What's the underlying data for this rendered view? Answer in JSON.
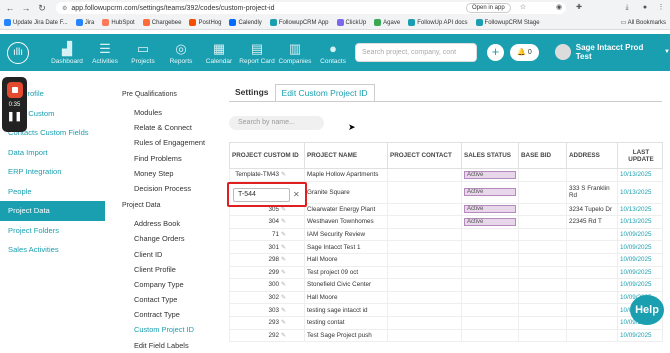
{
  "browser": {
    "url": "app.followupcrm.com/settings/teams/392/codes/custom-project-id",
    "open_in_app": "Open in app",
    "all_bookmarks": "All Bookmarks",
    "bookmarks": [
      {
        "label": "Update Jira Date F...",
        "color": "#2684ff"
      },
      {
        "label": "Jira",
        "color": "#2684ff"
      },
      {
        "label": "HubSpot",
        "color": "#ff7a59"
      },
      {
        "label": "Chargebee",
        "color": "#ff6c37"
      },
      {
        "label": "PostHog",
        "color": "#f54e00"
      },
      {
        "label": "Calendly",
        "color": "#006bff"
      },
      {
        "label": "FollowupCRM App",
        "color": "#1a9fb0"
      },
      {
        "label": "ClickUp",
        "color": "#7b68ee"
      },
      {
        "label": "Agave",
        "color": "#3aa757"
      },
      {
        "label": "FollowUp API docs",
        "color": "#1a9fb0"
      },
      {
        "label": "FollowupCRM Stage",
        "color": "#1a9fb0"
      }
    ]
  },
  "appbar": {
    "nav": [
      {
        "label": "Dashboard",
        "icon": "▟"
      },
      {
        "label": "Activities",
        "icon": "☰"
      },
      {
        "label": "Projects",
        "icon": "▭"
      },
      {
        "label": "Reports",
        "icon": "◎"
      },
      {
        "label": "Calendar",
        "icon": "▦"
      },
      {
        "label": "Report Card",
        "icon": "▤"
      },
      {
        "label": "Companies",
        "icon": "▥"
      },
      {
        "label": "Contacts",
        "icon": "●"
      }
    ],
    "search_placeholder": "Search project, company, cont",
    "notif_count": "0",
    "user_name": "Sage Intacct Prod Test"
  },
  "recorder": {
    "time": "0:35"
  },
  "sidebar": [
    {
      "label": "any Profile",
      "active": false
    },
    {
      "label": "anies Custom",
      "active": false
    },
    {
      "label": "Contacts Custom Fields",
      "active": false
    },
    {
      "label": "Data Import",
      "active": false
    },
    {
      "label": "ERP Integration",
      "active": false
    },
    {
      "label": "People",
      "active": false
    },
    {
      "label": "Project Data",
      "active": true
    },
    {
      "label": "Project Folders",
      "active": false
    },
    {
      "label": "Sales Activities",
      "active": false
    }
  ],
  "subnav": {
    "pre_heading": "Pre Qualifications",
    "pre_items": [
      "Modules",
      "Relate & Connect",
      "Rules of Engagement",
      "Find Problems",
      "Money Step",
      "Decision Process"
    ],
    "data_heading": "Project Data",
    "data_items": [
      "Address Book",
      "Change Orders",
      "Client ID",
      "Client Profile",
      "Company Type",
      "Contact Type",
      "Contract Type",
      "Custom Project ID",
      "Edit Field Labels"
    ],
    "active_item": "Custom Project ID"
  },
  "tabs": {
    "settings": "Settings",
    "edit": "Edit Custom Project ID"
  },
  "table": {
    "search_placeholder": "Search by name...",
    "headers": [
      "PROJECT CUSTOM ID",
      "PROJECT NAME",
      "PROJECT CONTACT",
      "SALES STATUS",
      "BASE BID",
      "ADDRESS",
      "LAST UPDATE"
    ],
    "edit_value": "T-544",
    "rows": [
      {
        "id": "Template-TM43",
        "name": "Maple Hollow Apartments",
        "contact": "",
        "status": "Active",
        "bid": "",
        "address": "",
        "date": "10/13/2025"
      },
      {
        "id": "",
        "name": "Granite Square",
        "contact": "",
        "status": "Active",
        "bid": "",
        "address": "333 S Franklin Rd",
        "date": "10/13/2025"
      },
      {
        "id": "305",
        "name": "Clearwater Energy Plant",
        "contact": "",
        "status": "Active",
        "bid": "",
        "address": "3234 Tupelo Dr",
        "date": "10/13/2025"
      },
      {
        "id": "304",
        "name": "Westhaven Townhomes",
        "contact": "",
        "status": "Active",
        "bid": "",
        "address": "22345 Rd T",
        "date": "10/13/2025"
      },
      {
        "id": "71",
        "name": "IAM Security Review",
        "contact": "",
        "status": "",
        "bid": "",
        "address": "",
        "date": "10/09/2025"
      },
      {
        "id": "301",
        "name": "Sage Intacct Test 1",
        "contact": "",
        "status": "",
        "bid": "",
        "address": "",
        "date": "10/09/2025"
      },
      {
        "id": "298",
        "name": "Hall Moore",
        "contact": "",
        "status": "",
        "bid": "",
        "address": "",
        "date": "10/09/2025"
      },
      {
        "id": "299",
        "name": "Test project 09 oct",
        "contact": "",
        "status": "",
        "bid": "",
        "address": "",
        "date": "10/09/2025"
      },
      {
        "id": "300",
        "name": "Stonefield Civic Center",
        "contact": "",
        "status": "",
        "bid": "",
        "address": "",
        "date": "10/09/2025"
      },
      {
        "id": "302",
        "name": "Hall Moore",
        "contact": "",
        "status": "",
        "bid": "",
        "address": "",
        "date": "10/09/2025"
      },
      {
        "id": "303",
        "name": "testing sage intacct id",
        "contact": "",
        "status": "",
        "bid": "",
        "address": "",
        "date": "10/09/2025"
      },
      {
        "id": "293",
        "name": "testing contat",
        "contact": "",
        "status": "",
        "bid": "",
        "address": "",
        "date": "10/09/2025"
      },
      {
        "id": "292",
        "name": "Test Sage Project push",
        "contact": "",
        "status": "",
        "bid": "",
        "address": "",
        "date": "10/09/2025"
      }
    ]
  },
  "help_label": "Help",
  "colors": {
    "brand": "#1a9fb0",
    "badge": "#e8d6ea",
    "highlight": "#e02020"
  }
}
